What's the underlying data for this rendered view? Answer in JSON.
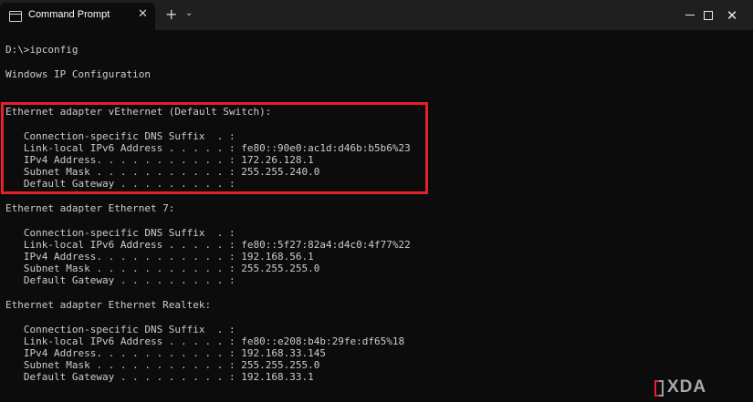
{
  "window": {
    "tab_title": "Command Prompt",
    "tab_close": "✕",
    "new_tab": "+",
    "dropdown": "⌄",
    "close": "✕"
  },
  "terminal": {
    "lines": [
      "D:\\>ipconfig",
      "Windows IP Configuration",
      "Ethernet adapter vEthernet (Default Switch):",
      "   Connection-specific DNS Suffix  . :",
      "   Link-local IPv6 Address . . . . . : fe80::90e0:ac1d:d46b:b5b6%23",
      "   IPv4 Address. . . . . . . . . . . : 172.26.128.1",
      "   Subnet Mask . . . . . . . . . . . : 255.255.240.0",
      "   Default Gateway . . . . . . . . . :",
      "Ethernet adapter Ethernet 7:",
      "   Connection-specific DNS Suffix  . :",
      "   Link-local IPv6 Address . . . . . : fe80::5f27:82a4:d4c0:4f77%22",
      "   IPv4 Address. . . . . . . . . . . : 192.168.56.1",
      "   Subnet Mask . . . . . . . . . . . : 255.255.255.0",
      "   Default Gateway . . . . . . . . . :",
      "Ethernet adapter Ethernet Realtek:",
      "   Connection-specific DNS Suffix  . :",
      "   Link-local IPv6 Address . . . . . : fe80::e208:b4b:29fe:df65%18",
      "   IPv4 Address. . . . . . . . . . . : 192.168.33.145",
      "   Subnet Mask . . . . . . . . . . . : 255.255.255.0",
      "   Default Gateway . . . . . . . . . : 192.168.33.1"
    ]
  },
  "watermark": {
    "text": "XDA"
  },
  "colors": {
    "terminal_bg": "#0c0c0c",
    "titlebar_bg": "#1f1f1f",
    "text": "#cccccc",
    "highlight": "#e4202a"
  }
}
